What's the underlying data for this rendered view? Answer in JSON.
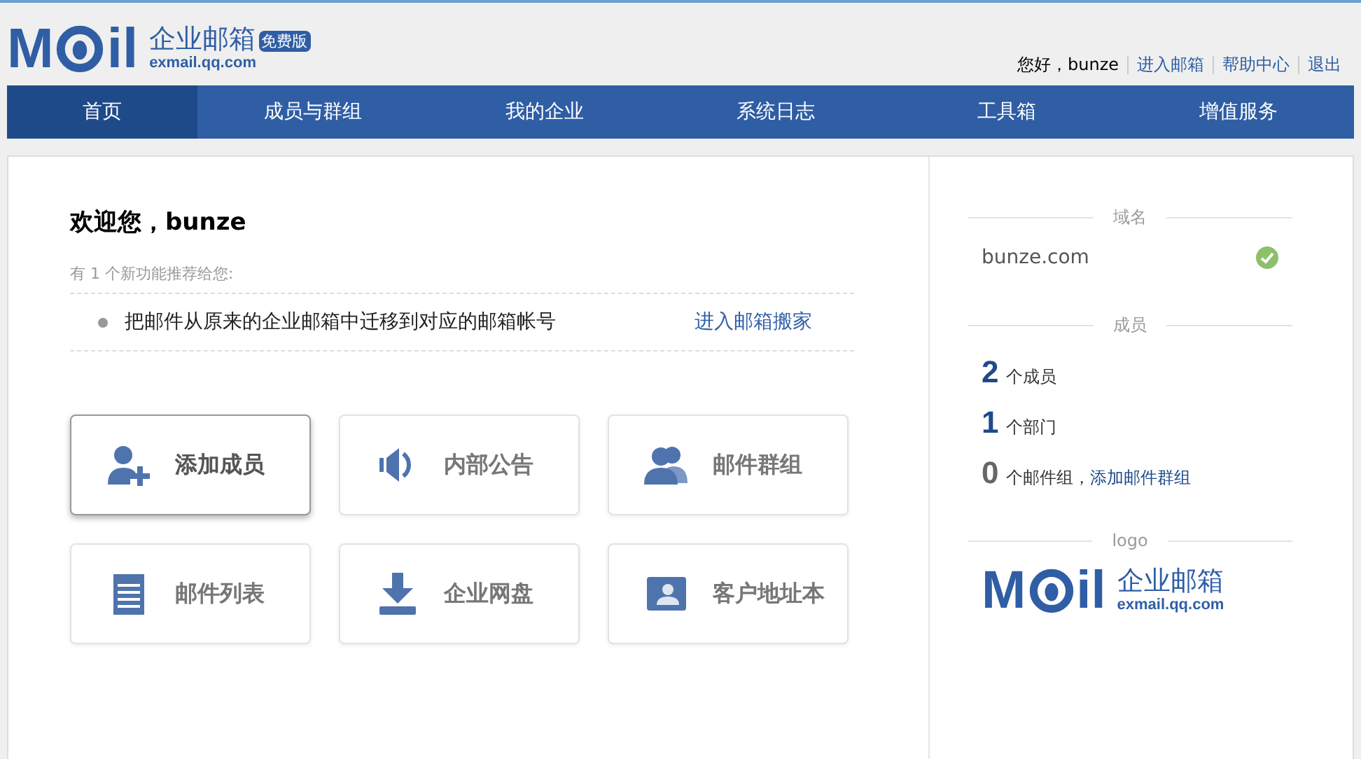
{
  "header": {
    "logo": {
      "left": "M",
      "right": "il",
      "name": "企业邮箱",
      "domain": "exmail.qq.com",
      "badge": "免费版"
    },
    "greeting": "您好，bunze",
    "links": [
      "进入邮箱",
      "帮助中心",
      "退出"
    ]
  },
  "nav": [
    {
      "label": "首页",
      "selected": true
    },
    {
      "label": "成员与群组",
      "selected": false
    },
    {
      "label": "我的企业",
      "selected": false
    },
    {
      "label": "系统日志",
      "selected": false
    },
    {
      "label": "工具箱",
      "selected": false
    },
    {
      "label": "增值服务",
      "selected": false
    }
  ],
  "welcome": "欢迎您，bunze",
  "recommend": {
    "intro": "有 1 个新功能推荐给您:",
    "items": [
      {
        "text": "把邮件从原来的企业邮箱中迁移到对应的邮箱帐号",
        "link": "进入邮箱搬家"
      }
    ]
  },
  "tiles": [
    {
      "kind": "add-member",
      "label": "添加成员",
      "selected": true
    },
    {
      "kind": "announcement",
      "label": "内部公告",
      "selected": false
    },
    {
      "kind": "group",
      "label": "邮件群组",
      "selected": false
    },
    {
      "kind": "list",
      "label": "邮件列表",
      "selected": false
    },
    {
      "kind": "disk",
      "label": "企业网盘",
      "selected": false
    },
    {
      "kind": "contacts",
      "label": "客户地址本",
      "selected": false
    }
  ],
  "sidebar": {
    "domain_heading": "域名",
    "domain": "bunze.com",
    "domain_verified": true,
    "members_heading": "成员",
    "stats": [
      {
        "count": "2",
        "label": "个成员",
        "highlighted": true
      },
      {
        "count": "1",
        "label": "个部门",
        "highlighted": true
      },
      {
        "count": "0",
        "label": "个邮件组，",
        "highlighted": false,
        "link": "添加邮件群组"
      }
    ],
    "logo_heading": "logo",
    "logo": {
      "left": "M",
      "right": "il",
      "name": "企业邮箱",
      "domain": "exmail.qq.com"
    }
  }
}
